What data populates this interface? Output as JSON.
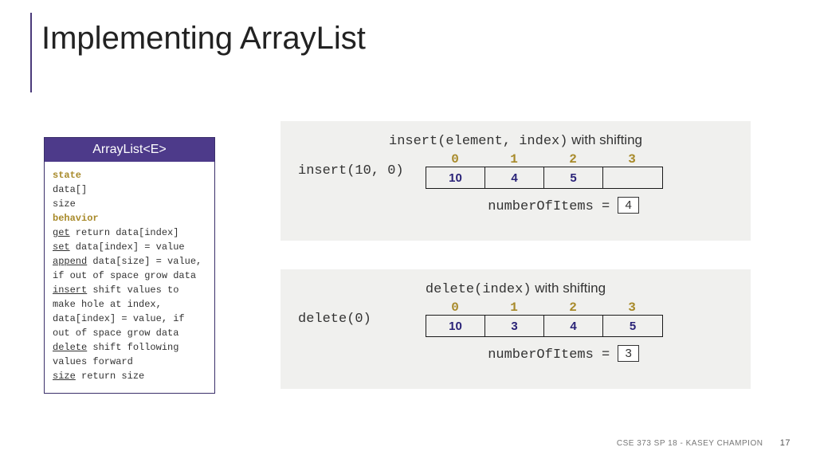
{
  "title": "Implementing ArrayList",
  "card": {
    "header": "ArrayList<E>",
    "state_label": "state",
    "state_1": "data[]",
    "state_2": "size",
    "behavior_label": "behavior",
    "get_fn": "get",
    "get_desc": " return data[index]",
    "set_fn": "set",
    "set_desc": " data[index] = value",
    "append_fn": "append",
    "append_desc": " data[size] = value, if out of space grow data",
    "insert_fn": "insert",
    "insert_desc": " shift values to make hole at index, data[index] = value, if out of space grow data",
    "delete_fn": "delete",
    "delete_desc": " shift following values forward",
    "size_fn": "size",
    "size_desc": " return size"
  },
  "panel1": {
    "title_code": "insert(element, index)",
    "title_suffix": " with shifting",
    "op": "insert(10, 0)",
    "idx": [
      "0",
      "1",
      "2",
      "3"
    ],
    "cells": [
      "10",
      "4",
      "5",
      ""
    ],
    "count_label": "numberOfItems = ",
    "count_value": "4"
  },
  "panel2": {
    "title_code": "delete(index)",
    "title_suffix": " with shifting",
    "op": "delete(0)",
    "idx": [
      "0",
      "1",
      "2",
      "3"
    ],
    "cells": [
      "10",
      "3",
      "4",
      "5"
    ],
    "count_label": "numberOfItems = ",
    "count_value": "3"
  },
  "footer": {
    "text": "CSE 373 SP 18 - KASEY CHAMPION",
    "page": "17"
  }
}
